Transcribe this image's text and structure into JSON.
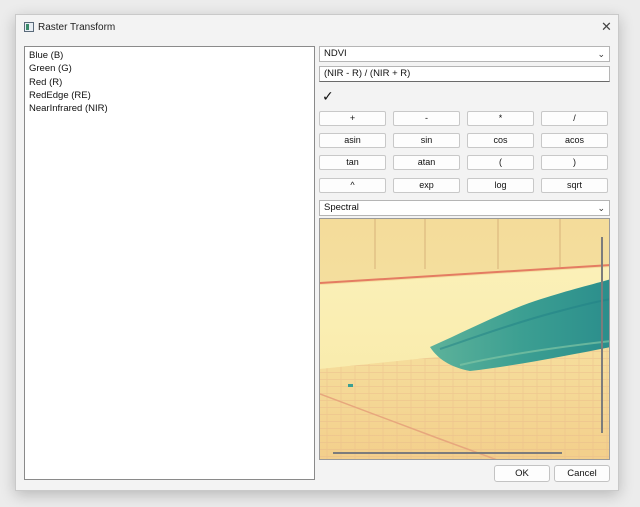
{
  "window": {
    "title": "Raster Transform",
    "close_glyph": "✕"
  },
  "bands": [
    "Blue (B)",
    "Green (G)",
    "Red (R)",
    "RedEdge (RE)",
    "NearInfrared (NIR)"
  ],
  "index_select": {
    "value": "NDVI"
  },
  "expression": {
    "value": "(NIR - R) / (NIR + R)"
  },
  "validation": {
    "glyph": "✓",
    "icon": "checkmark-icon"
  },
  "operator_buttons": [
    [
      "+",
      "-",
      "*",
      "/"
    ],
    [
      "asin",
      "sin",
      "cos",
      "acos"
    ],
    [
      "tan",
      "atan",
      "(",
      ")"
    ],
    [
      "^",
      "exp",
      "log",
      "sqrt"
    ]
  ],
  "colormap_select": {
    "value": "Spectral"
  },
  "preview": {
    "colormap": "Spectral",
    "dominant_colors": [
      "#f7e9a4",
      "#2f9a8f",
      "#f08a6e"
    ]
  },
  "dialog_buttons": {
    "ok": "OK",
    "cancel": "Cancel"
  }
}
